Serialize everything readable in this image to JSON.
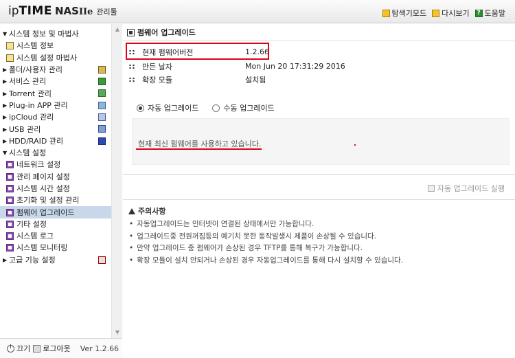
{
  "header": {
    "logo_ip": "ip",
    "logo_time": "TIME",
    "logo_nas": "NAS",
    "logo_ver": "IIe",
    "logo_tool": "관리툴",
    "links": [
      {
        "label": "탐색기모드",
        "icon": "explorer-icon"
      },
      {
        "label": "다시보기",
        "icon": "refresh-icon"
      },
      {
        "label": "도움말",
        "icon": "help-icon"
      }
    ]
  },
  "sidebar": {
    "items": [
      {
        "label": "시스템 정보 및 마법사",
        "level": 0,
        "expanded": true
      },
      {
        "label": "시스템 정보",
        "level": 1
      },
      {
        "label": "시스템 설정 마법사",
        "level": 1
      },
      {
        "label": "폴더/사용자 관리",
        "level": 0
      },
      {
        "label": "서비스 관리",
        "level": 0
      },
      {
        "label": "Torrent 관리",
        "level": 0
      },
      {
        "label": "Plug-in APP 관리",
        "level": 0
      },
      {
        "label": "ipCloud 관리",
        "level": 0
      },
      {
        "label": "USB 관리",
        "level": 0
      },
      {
        "label": "HDD/RAID 관리",
        "level": 0
      },
      {
        "label": "시스템 설정",
        "level": 0,
        "expanded": true
      },
      {
        "label": "네트워크 설정",
        "level": 1
      },
      {
        "label": "관리 페이지 설정",
        "level": 1
      },
      {
        "label": "시스템 시간 설정",
        "level": 1
      },
      {
        "label": "초기화 및 설정 관리",
        "level": 1
      },
      {
        "label": "펌웨어 업그레이드",
        "level": 1,
        "selected": true
      },
      {
        "label": "기타 설정",
        "level": 1
      },
      {
        "label": "시스템 로그",
        "level": 1
      },
      {
        "label": "시스템 모니터링",
        "level": 1
      },
      {
        "label": "고급 기능 설정",
        "level": 0
      }
    ],
    "footer": {
      "power_label": "끄기",
      "logout_label": "로그아웃",
      "version": "Ver 1.2.66"
    }
  },
  "main": {
    "title": "펌웨어 업그레이드",
    "info": [
      {
        "label": "현재 펌웨어버전",
        "value": "1.2.66"
      },
      {
        "label": "만든 날자",
        "value": "Mon Jun 20 17:31:29 2016"
      },
      {
        "label": "확장 모듈",
        "value": "설치됨"
      }
    ],
    "radio_auto": "자동 업그레이드",
    "radio_manual": "수동 업그레이드",
    "selected_mode": "auto",
    "status_text": "현재 최신 펌웨어를 사용하고 있습니다.",
    "auto_run_label": "자동 업그레이드 실행",
    "notice_title": "주의사항",
    "notices": [
      "자동업그레이드는 인터넷이 연결된 상태에서만 가능합니다.",
      "업그레이드중 전원꺼짐등의 예기치 못한 동작발생시 제품이 손상될 수 있습니다.",
      "만약 업그레이드 중 펌웨어가 손상된 경우 TFTP를 통해 복구가 가능합니다.",
      "확장 모듈이 설치 안되거나 손상된 경우 자동업그레이드를 통해 다시 설치할 수 있습니다."
    ]
  },
  "colors": {
    "highlight": "#e0001a",
    "selected_row": "#c8d8ea"
  }
}
